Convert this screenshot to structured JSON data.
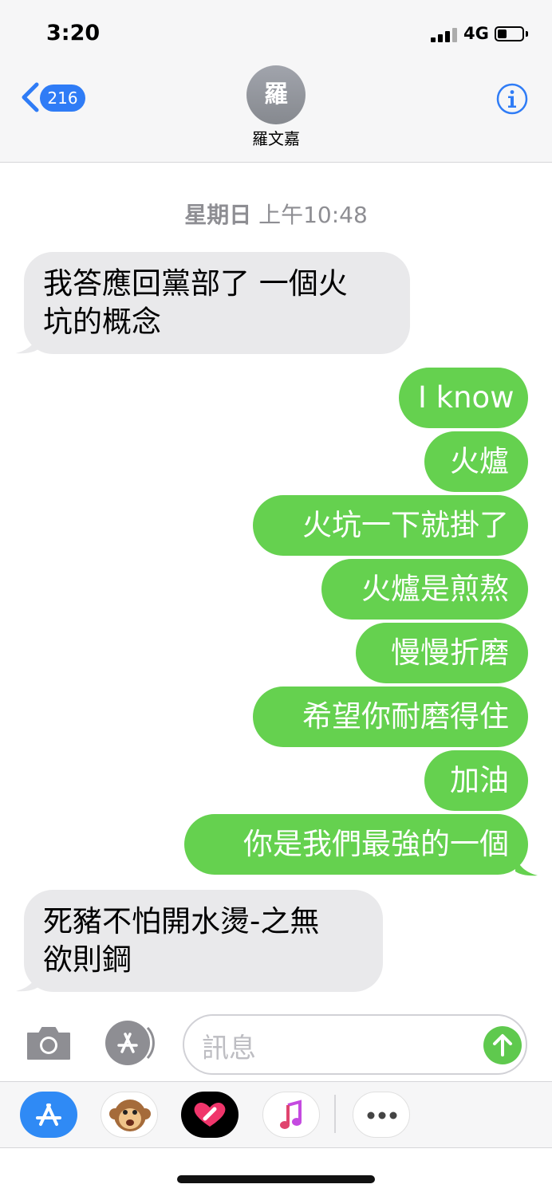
{
  "status_bar": {
    "time": "3:20",
    "network": "4G",
    "battery_level": 0.3
  },
  "header": {
    "back_count": "216",
    "avatar_initial": "羅",
    "contact_name": "羅文嘉",
    "colors": {
      "accent": "#2f7cf6",
      "header_bg": "#f6f6f7"
    }
  },
  "thread": {
    "timestamp_day": "星期日",
    "timestamp_time": "上午10:48",
    "messages": [
      {
        "side": "in",
        "text": "我答應回黨部了 一個火\n坑的概念"
      },
      {
        "side": "out",
        "text": "I know"
      },
      {
        "side": "out",
        "text": "火爐"
      },
      {
        "side": "out",
        "text": "火坑一下就掛了"
      },
      {
        "side": "out",
        "text": "火爐是煎熬"
      },
      {
        "side": "out",
        "text": "慢慢折磨"
      },
      {
        "side": "out",
        "text": "希望你耐磨得住"
      },
      {
        "side": "out",
        "text": "加油"
      },
      {
        "side": "out",
        "text": "你是我們最強的一個"
      },
      {
        "side": "in",
        "text": "死豬不怕開水燙-之無\n欲則鋼"
      }
    ],
    "colors": {
      "incoming_bubble": "#e9e9eb",
      "outgoing_bubble": "#65d14f"
    }
  },
  "compose": {
    "placeholder": "訊息",
    "send_color": "#5fc94e"
  },
  "drawer": {
    "items": [
      "app-store-icon",
      "animoji-icon",
      "digital-touch-icon",
      "music-icon",
      "more-icon"
    ]
  }
}
